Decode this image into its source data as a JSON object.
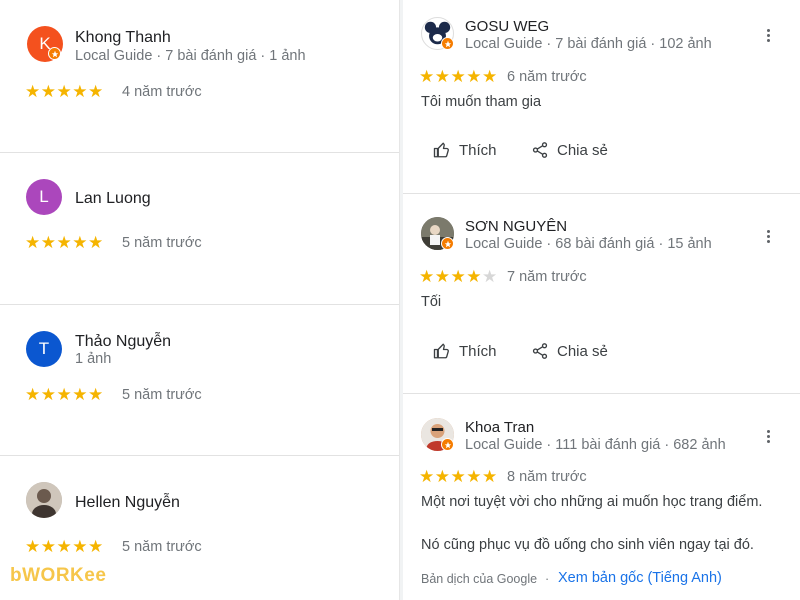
{
  "left_reviews": [
    {
      "name": "Khong Thanh",
      "meta": "Local Guide · 7 bài đánh giá · 1 ảnh",
      "time": "4 năm trước",
      "avatar_letter": "K",
      "avatar_color": "#f4511e",
      "rating": 5
    },
    {
      "name": "Lan Luong",
      "meta": "",
      "time": "5 năm trước",
      "avatar_letter": "L",
      "avatar_color": "#ab47bc",
      "rating": 5
    },
    {
      "name": "Thảo Nguyễn",
      "meta": "1 ảnh",
      "time": "5 năm trước",
      "avatar_letter": "T",
      "avatar_color": "#0b57d0",
      "rating": 5
    },
    {
      "name": "Hellen Nguyễn",
      "meta": "",
      "time": "5 năm trước",
      "avatar_letter": "",
      "avatar_color": "#b0a79f",
      "rating": 5
    }
  ],
  "right_reviews": [
    {
      "name": "GOSU WEG",
      "meta": "Local Guide · 7 bài đánh giá · 102 ảnh",
      "time": "6 năm trước",
      "text": "Tôi muốn tham gia",
      "rating": 5,
      "avatar_color": "#1c2a4a"
    },
    {
      "name": "SƠN NGUYÊN",
      "meta": "Local Guide · 68 bài đánh giá · 15 ảnh",
      "time": "7 năm trước",
      "text": "Tối",
      "rating": 4,
      "avatar_color": "#5a5a52"
    },
    {
      "name": "Khoa Tran",
      "meta": "Local Guide · 111 bài đánh giá · 682 ảnh",
      "time": "8 năm trước",
      "text": "Một nơi tuyệt vời cho những ai muốn học trang điểm.",
      "text2": "Nó cũng phục vụ đồ uống cho sinh viên ngay tại đó.",
      "rating": 5,
      "avatar_color": "#d9a27a"
    }
  ],
  "actions": {
    "like": "Thích",
    "share": "Chia sẻ"
  },
  "translation": {
    "label": "Bản dịch của Google",
    "separator": "·",
    "link": "Xem bản gốc (Tiếng Anh)"
  },
  "watermark": {
    "part1": "bWORK",
    "part2": "ee",
    "color1": "#f6c64a",
    "color2": "#f6c64a"
  },
  "colors": {
    "star": "#f5b400",
    "star_off": "#d7d7d7",
    "link": "#1a73e8",
    "badge": "#f57c00"
  },
  "icons": {
    "like": "thumb-up-icon",
    "share": "share-icon",
    "more": "more-vert-icon",
    "guide": "local-guide-badge-icon"
  }
}
